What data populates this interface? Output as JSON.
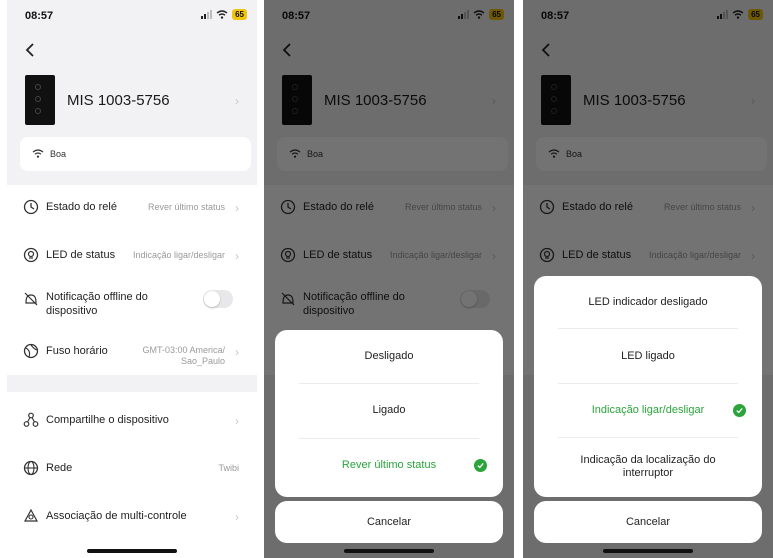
{
  "status": {
    "time": "08:57",
    "battery": "65"
  },
  "device": {
    "name": "MIS 1003-5756"
  },
  "wifi": {
    "label": "Boa"
  },
  "settings": {
    "relay": {
      "label": "Estado do relé",
      "value": "Rever último status"
    },
    "led": {
      "label": "LED de status",
      "value": "Indicação ligar/desligar"
    },
    "offline": {
      "label_line1": "Notificação offline do",
      "label_line2": "dispositivo"
    },
    "timezone": {
      "label": "Fuso horário",
      "value_line1": "GMT-03:00 America/",
      "value_line2": "Sao_Paulo"
    },
    "share": {
      "label": "Compartilhe o dispositivo"
    },
    "network": {
      "label": "Rede",
      "value": "Twibi"
    },
    "multi": {
      "label": "Associação de multi-controle"
    }
  },
  "relay_sheet": {
    "options": [
      "Desligado",
      "Ligado",
      "Rever último status"
    ],
    "selected": "Rever último status",
    "cancel": "Cancelar"
  },
  "led_sheet": {
    "options": [
      "LED indicador desligado",
      "LED ligado",
      "Indicação ligar/desligar"
    ],
    "option4_line1": "Indicação da localização do",
    "option4_line2": "interruptor",
    "selected": "Indicação ligar/desligar",
    "cancel": "Cancelar"
  },
  "colors": {
    "accent": "#2aa43b",
    "battery": "#f1c40f"
  }
}
